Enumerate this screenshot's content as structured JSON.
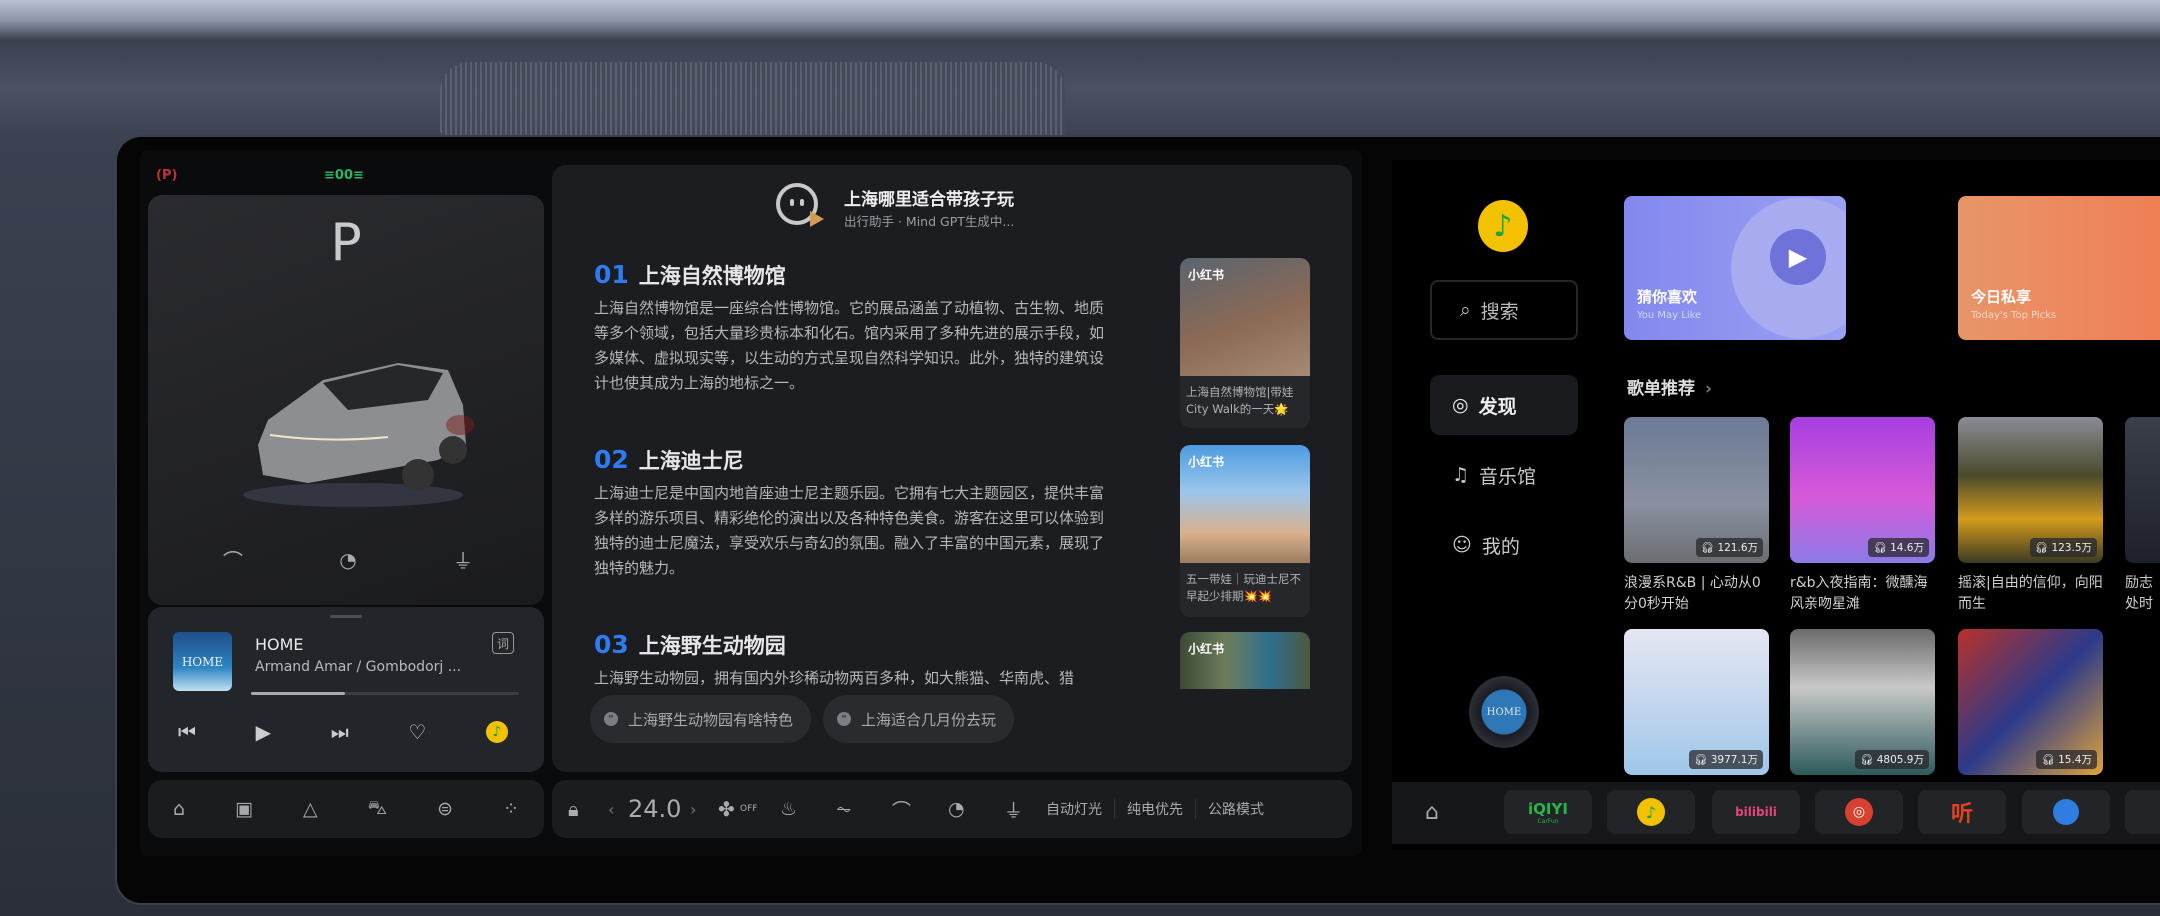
{
  "status": {
    "parking_brake_icon": "parking-brake-icon",
    "parking_brake_color": "#c0323a",
    "lights_icon": "position-lights-icon",
    "lights_color": "#2bb56a"
  },
  "vehicle": {
    "gear": "P",
    "quick_actions": [
      "wiper-icon",
      "mirror-fold-icon",
      "charge-port-icon"
    ]
  },
  "music": {
    "title": "HOME",
    "artist": "Armand Amar / Gombodorj ...",
    "album_text": "HOME",
    "progress": 0.35,
    "lyrics_label": "词"
  },
  "left_nav": [
    "home-icon",
    "camera-icon",
    "navigation-icon",
    "car-icon",
    "toggle-icon",
    "apps-icon"
  ],
  "assistant": {
    "question": "上海哪里适合带孩子玩",
    "status": "出行助手 · Mind GPT生成中...",
    "items": [
      {
        "num": "01",
        "title": "上海自然博物馆",
        "body": "上海自然博物馆是一座综合性博物馆。它的展品涵盖了动植物、古生物、地质等多个领域，包括大量珍贵标本和化石。馆内采用了多种先进的展示手段，如多媒体、虚拟现实等，以生动的方式呈现自然科学知识。此外，独特的建筑设计也使其成为上海的地标之一。",
        "tag": "小红书",
        "caption": "上海自然博物馆|带娃City Walk的一天🌟"
      },
      {
        "num": "02",
        "title": "上海迪士尼",
        "body": "上海迪士尼是中国内地首座迪士尼主题乐园。它拥有七大主题园区，提供丰富多样的游乐项目、精彩绝伦的演出以及各种特色美食。游客在这里可以体验到独特的迪士尼魔法，享受欢乐与奇幻的氛围。融入了丰富的中国元素，展现了独特的魅力。",
        "tag": "小红书",
        "caption": "五一带娃｜玩迪士尼不早起少排期💥💥"
      },
      {
        "num": "03",
        "title": "上海野生动物园",
        "body": "上海野生动物园，拥有国内外珍稀动物两百多种，如大熊猫、华南虎、猎",
        "tag": "小红书",
        "caption": ""
      }
    ],
    "suggestions": [
      "上海野生动物园有啥特色",
      "上海适合几月份去玩"
    ]
  },
  "climate": {
    "temperature": "24.0",
    "fan": "OFF",
    "modes": [
      "自动灯光",
      "纯电优先",
      "公路模式"
    ]
  },
  "qqmusic": {
    "search": "搜索",
    "nav": [
      "发现",
      "音乐馆",
      "我的"
    ],
    "banners": [
      {
        "title": "猜你喜欢",
        "subtitle": "You May Like"
      },
      {
        "title": "今日私享",
        "subtitle": "Today's Top Picks"
      }
    ],
    "section": "歌单推荐",
    "playlists": [
      {
        "title": "浪漫系R&B | 心动从0分0秒开始",
        "plays": "121.6万"
      },
      {
        "title": "r&b入夜指南：微醺海风亲吻星滩",
        "plays": "14.6万"
      },
      {
        "title": "摇滚|自由的信仰，向阳而生",
        "plays": "123.5万"
      },
      {
        "title": "励志处时",
        "plays": ""
      },
      {
        "title": "",
        "plays": "3977.1万"
      },
      {
        "title": "",
        "plays": "4805.9万"
      },
      {
        "title": "",
        "plays": "15.4万"
      }
    ],
    "now_playing_disc": "HOME"
  },
  "dock": {
    "apps": [
      "iQIYI",
      "QQ音乐",
      "bilibili",
      "网易云音乐",
      "听",
      "浏览器"
    ],
    "iqiyi_sub": "CarFun"
  }
}
